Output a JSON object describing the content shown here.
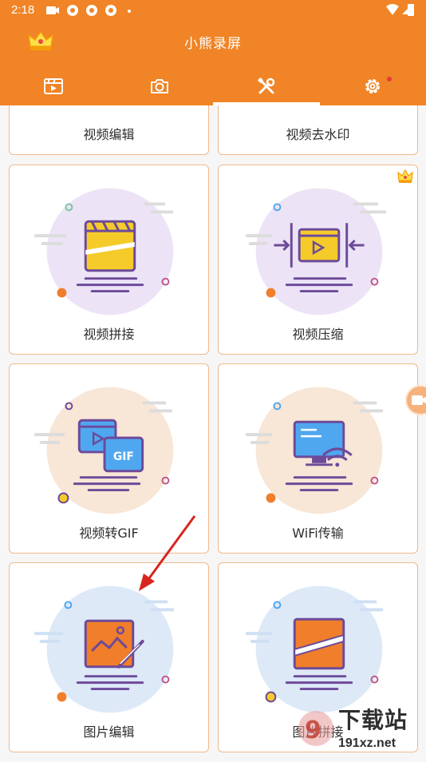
{
  "status_bar": {
    "time": "2:18"
  },
  "app": {
    "title": "小熊录屏"
  },
  "tabs": [
    {
      "name": "video-tab-icon"
    },
    {
      "name": "camera-tab-icon"
    },
    {
      "name": "tools-tab-icon"
    },
    {
      "name": "settings-tab-icon"
    }
  ],
  "tools": [
    {
      "label": "视频编辑"
    },
    {
      "label": "视频去水印"
    },
    {
      "label": "视频拼接"
    },
    {
      "label": "视频压缩"
    },
    {
      "label": "视频转GIF"
    },
    {
      "label": "WiFi传输"
    },
    {
      "label": "图片编辑"
    },
    {
      "label": "图片拼接"
    }
  ],
  "illustrations": {
    "gif_label": "GIF"
  },
  "watermark": {
    "line1": "下载站",
    "line2": "191xz.net"
  },
  "colors": {
    "accent": "#f08426",
    "card_border": "#efb98c",
    "circle_purple": "#ece4f6",
    "circle_beige": "#f8e6d6",
    "circle_blue": "#dde9f7",
    "icon_yellow": "#f5cb2a",
    "icon_blue": "#4fa7f0",
    "icon_orange": "#f0822a",
    "line_purple": "#6d4a9a",
    "arrow_red": "#d8261f"
  }
}
